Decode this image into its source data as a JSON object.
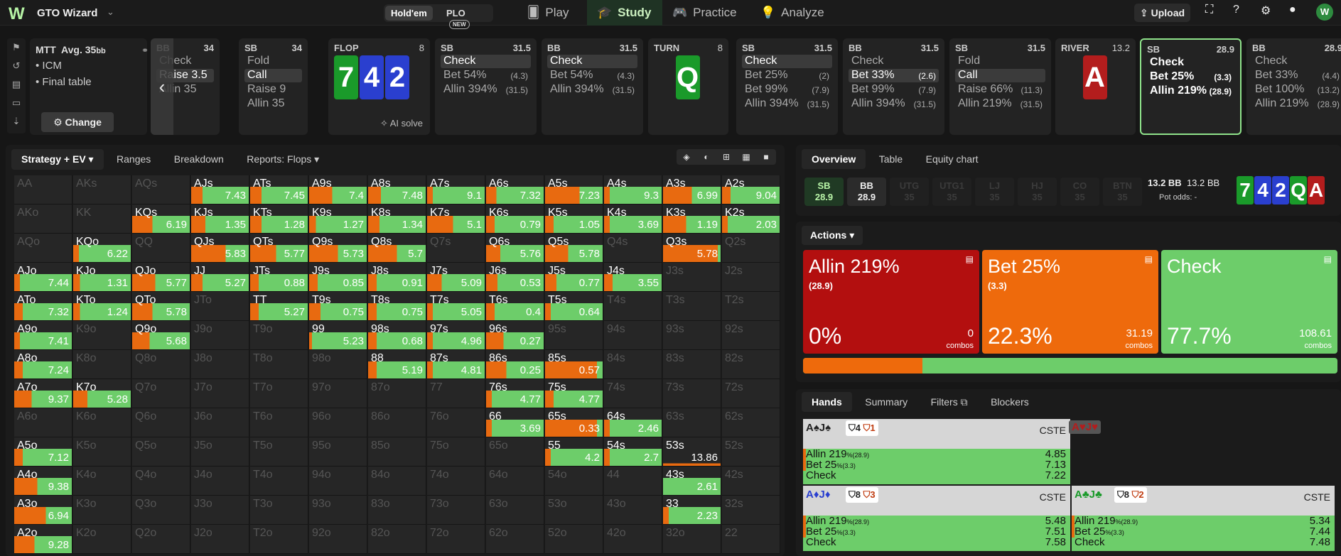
{
  "app": {
    "brand": "GTO Wizard",
    "logo": "W"
  },
  "game_toggle": {
    "holdem": "Hold'em",
    "plo": "PLO",
    "plo_badge": "NEW"
  },
  "nav": {
    "play": "Play",
    "study": "Study",
    "practice": "Practice",
    "analyze": "Analyze"
  },
  "topright": {
    "upload": "Upload",
    "avatar": "W"
  },
  "mtt": {
    "title": "MTT",
    "avg": "Avg. 35",
    "avg_unit": "bb",
    "icm": "• ICM",
    "final_table": "• Final table",
    "change": "Change"
  },
  "path": [
    {
      "pos": "BB",
      "stack": "34",
      "actions": [
        {
          "t": "Check",
          "s": ""
        },
        {
          "t": "Raise 3.5",
          "s": ""
        },
        {
          "t": "Allin 35",
          "s": ""
        }
      ],
      "selected": 1
    },
    {
      "pos": "SB",
      "stack": "34",
      "actions": [
        {
          "t": "Fold",
          "s": ""
        },
        {
          "t": "Call",
          "s": ""
        },
        {
          "t": "Raise 9",
          "s": ""
        },
        {
          "t": "Allin 35",
          "s": ""
        }
      ],
      "selected": 1
    },
    {
      "street": "FLOP",
      "pot": "8",
      "cards": [
        "7",
        "4",
        "2"
      ],
      "ai": "AI solve"
    },
    {
      "pos": "SB",
      "stack": "31.5",
      "actions": [
        {
          "t": "Check",
          "s": ""
        },
        {
          "t": "Bet 54%",
          "s": "(4.3)"
        },
        {
          "t": "Allin 394%",
          "s": "(31.5)"
        }
      ],
      "selected": 0
    },
    {
      "pos": "BB",
      "stack": "31.5",
      "actions": [
        {
          "t": "Check",
          "s": ""
        },
        {
          "t": "Bet 54%",
          "s": "(4.3)"
        },
        {
          "t": "Allin 394%",
          "s": "(31.5)"
        }
      ],
      "selected": 0
    },
    {
      "street": "TURN",
      "pot": "8",
      "cards": [
        "Q"
      ]
    },
    {
      "pos": "SB",
      "stack": "31.5",
      "actions": [
        {
          "t": "Check",
          "s": ""
        },
        {
          "t": "Bet 25%",
          "s": "(2)"
        },
        {
          "t": "Bet 99%",
          "s": "(7.9)"
        },
        {
          "t": "Allin 394%",
          "s": "(31.5)"
        }
      ],
      "selected": 0
    },
    {
      "pos": "BB",
      "stack": "31.5",
      "actions": [
        {
          "t": "Check",
          "s": ""
        },
        {
          "t": "Bet 33%",
          "s": "(2.6)"
        },
        {
          "t": "Bet 99%",
          "s": "(7.9)"
        },
        {
          "t": "Allin 394%",
          "s": "(31.5)"
        }
      ],
      "selected": 1
    },
    {
      "pos": "SB",
      "stack": "31.5",
      "actions": [
        {
          "t": "Fold",
          "s": ""
        },
        {
          "t": "Call",
          "s": ""
        },
        {
          "t": "Raise 66%",
          "s": "(11.3)"
        },
        {
          "t": "Allin 219%",
          "s": "(31.5)"
        }
      ],
      "selected": 1
    },
    {
      "street": "RIVER",
      "pot": "13.2",
      "cards": [
        "A"
      ]
    },
    {
      "pos": "SB",
      "stack": "28.9",
      "actions": [
        {
          "t": "Check",
          "s": ""
        },
        {
          "t": "Bet 25%",
          "s": "(3.3)"
        },
        {
          "t": "Allin 219%",
          "s": "(28.9)"
        }
      ],
      "selected": -1,
      "active": true
    },
    {
      "pos": "BB",
      "stack": "28.9",
      "actions": [
        {
          "t": "Check",
          "s": ""
        },
        {
          "t": "Bet 33%",
          "s": "(4.4)"
        },
        {
          "t": "Bet 100%",
          "s": "(13.2)"
        },
        {
          "t": "Allin 219%",
          "s": "(28.9)"
        }
      ],
      "selected": -1
    }
  ],
  "left_tabs": [
    "Strategy + EV ▾",
    "Ranges",
    "Breakdown",
    "Reports: Flops ▾"
  ],
  "view_tools": [
    "◈",
    "◐",
    "⊞",
    "▦",
    "■"
  ],
  "colors": {
    "green": "#6dcd6a",
    "orange": "#e86a10",
    "red": "#b31d1d",
    "empty": "#262626"
  },
  "matrix": [
    [
      [
        "AA"
      ],
      [
        "AKs"
      ],
      [
        "AQs"
      ],
      [
        "AJs",
        "7.43",
        0.2,
        0
      ],
      [
        "ATs",
        "7.45",
        0.2,
        0
      ],
      [
        "A9s",
        "7.4",
        0.4,
        0
      ],
      [
        "A8s",
        "7.48",
        0.22,
        0
      ],
      [
        "A7s",
        "9.1",
        0.1,
        0
      ],
      [
        "A6s",
        "7.32",
        0.18,
        0
      ],
      [
        "A5s",
        "7.23",
        0.6,
        0
      ],
      [
        "A4s",
        "9.3",
        0.1,
        0
      ],
      [
        "A3s",
        "6.99",
        0.5,
        0
      ],
      [
        "A2s",
        "9.04",
        0.15,
        0
      ]
    ],
    [
      [
        "AKo"
      ],
      [
        "KK"
      ],
      [
        "KQs",
        "6.19",
        0.35,
        0
      ],
      [
        "KJs",
        "1.35",
        0.25,
        0
      ],
      [
        "KTs",
        "1.28",
        0.2,
        0
      ],
      [
        "K9s",
        "1.27",
        0.12,
        0
      ],
      [
        "K8s",
        "1.34",
        0.2,
        0
      ],
      [
        "K7s",
        "5.1",
        0.45,
        0
      ],
      [
        "K6s",
        "0.79",
        0.15,
        0
      ],
      [
        "K5s",
        "1.05",
        0.15,
        0
      ],
      [
        "K4s",
        "3.69",
        0.1,
        0
      ],
      [
        "K3s",
        "1.19",
        0.4,
        0
      ],
      [
        "K2s",
        "2.03",
        0.1,
        0
      ]
    ],
    [
      [
        "AQo"
      ],
      [
        "KQo",
        "6.22",
        0.1,
        0
      ],
      [
        "QQ"
      ],
      [
        "QJs",
        "5.83",
        0.6,
        0
      ],
      [
        "QTs",
        "5.77",
        0.45,
        0
      ],
      [
        "Q9s",
        "5.73",
        0.5,
        0
      ],
      [
        "Q8s",
        "5.7",
        0.5,
        0
      ],
      [
        "Q7s"
      ],
      [
        "Q6s",
        "5.76",
        0.25,
        0
      ],
      [
        "Q5s",
        "5.78",
        0.4,
        0
      ],
      [
        "Q4s"
      ],
      [
        "Q3s",
        "5.78",
        0.95,
        0
      ],
      [
        "Q2s"
      ]
    ],
    [
      [
        "AJo",
        "7.44",
        0.1,
        0
      ],
      [
        "KJo",
        "1.31",
        0.12,
        0
      ],
      [
        "QJo",
        "5.77",
        0.4,
        0
      ],
      [
        "JJ",
        "5.27",
        0.2,
        0
      ],
      [
        "JTs",
        "0.88",
        0.15,
        0
      ],
      [
        "J9s",
        "0.85",
        0.15,
        0
      ],
      [
        "J8s",
        "0.91",
        0.15,
        0
      ],
      [
        "J7s",
        "5.09",
        0.25,
        0
      ],
      [
        "J6s",
        "0.53",
        0.2,
        0
      ],
      [
        "J5s",
        "0.77",
        0.2,
        0
      ],
      [
        "J4s",
        "3.55",
        0.15,
        0
      ],
      [
        "J3s"
      ],
      [
        "J2s"
      ]
    ],
    [
      [
        "ATo",
        "7.32",
        0.15,
        0
      ],
      [
        "KTo",
        "1.24",
        0.12,
        0
      ],
      [
        "QTo",
        "5.78",
        0.35,
        0
      ],
      [
        "JTo"
      ],
      [
        "TT",
        "5.27",
        0.15,
        0
      ],
      [
        "T9s",
        "0.75",
        0.2,
        0
      ],
      [
        "T8s",
        "0.75",
        0.15,
        0
      ],
      [
        "T7s",
        "5.05",
        0.1,
        0
      ],
      [
        "T6s",
        "0.4",
        0.15,
        0
      ],
      [
        "T5s",
        "0.64",
        0.1,
        0
      ],
      [
        "T4s"
      ],
      [
        "T3s"
      ],
      [
        "T2s"
      ]
    ],
    [
      [
        "A9o",
        "7.41",
        0.1,
        0
      ],
      [
        "K9o"
      ],
      [
        "Q9o",
        "5.68",
        0.3,
        0
      ],
      [
        "J9o"
      ],
      [
        "T9o"
      ],
      [
        "99",
        "5.23",
        0.05,
        0
      ],
      [
        "98s",
        "0.68",
        0.15,
        0
      ],
      [
        "97s",
        "4.96",
        0.1,
        0
      ],
      [
        "96s",
        "0.27",
        0.3,
        0
      ],
      [
        "95s"
      ],
      [
        "94s"
      ],
      [
        "93s"
      ],
      [
        "92s"
      ]
    ],
    [
      [
        "A8o",
        "7.24",
        0.15,
        0
      ],
      [
        "K8o"
      ],
      [
        "Q8o"
      ],
      [
        "J8o"
      ],
      [
        "T8o"
      ],
      [
        "98o"
      ],
      [
        "88",
        "5.19",
        0.15,
        0
      ],
      [
        "87s",
        "4.81",
        0.1,
        0
      ],
      [
        "86s",
        "0.25",
        0.35,
        0
      ],
      [
        "85s",
        "0.57",
        0.9,
        0
      ],
      [
        "84s"
      ],
      [
        "83s"
      ],
      [
        "82s"
      ]
    ],
    [
      [
        "A7o",
        "9.37",
        0.3,
        0
      ],
      [
        "K7o",
        "5.28",
        0.25,
        0
      ],
      [
        "Q7o"
      ],
      [
        "J7o"
      ],
      [
        "T7o"
      ],
      [
        "97o"
      ],
      [
        "87o"
      ],
      [
        "77"
      ],
      [
        "76s",
        "4.77",
        0.1,
        0
      ],
      [
        "75s",
        "4.77",
        0.15,
        0
      ],
      [
        "74s"
      ],
      [
        "73s"
      ],
      [
        "72s"
      ]
    ],
    [
      [
        "A6o"
      ],
      [
        "K6o"
      ],
      [
        "Q6o"
      ],
      [
        "J6o"
      ],
      [
        "T6o"
      ],
      [
        "96o"
      ],
      [
        "86o"
      ],
      [
        "76o"
      ],
      [
        "66",
        "3.69",
        0.1,
        0
      ],
      [
        "65s",
        "0.33",
        0.9,
        0
      ],
      [
        "64s",
        "2.46",
        0.1,
        0
      ],
      [
        "63s"
      ],
      [
        "62s"
      ]
    ],
    [
      [
        "A5o",
        "7.12",
        0.15,
        0
      ],
      [
        "K5o"
      ],
      [
        "Q5o"
      ],
      [
        "J5o"
      ],
      [
        "T5o"
      ],
      [
        "95o"
      ],
      [
        "85o"
      ],
      [
        "75o"
      ],
      [
        "65o"
      ],
      [
        "55",
        "4.2",
        0.1,
        0
      ],
      [
        "54s",
        "2.7",
        0.1,
        0
      ],
      [
        "53s",
        "13.86",
        0.1,
        0.85
      ],
      [
        "52s"
      ]
    ],
    [
      [
        "A4o",
        "9.38",
        0.4,
        0
      ],
      [
        "K4o"
      ],
      [
        "Q4o"
      ],
      [
        "J4o"
      ],
      [
        "T4o"
      ],
      [
        "94o"
      ],
      [
        "84o"
      ],
      [
        "74o"
      ],
      [
        "64o"
      ],
      [
        "54o"
      ],
      [
        "44"
      ],
      [
        "43s",
        "2.61",
        0.0,
        0
      ],
      [
        "42s"
      ]
    ],
    [
      [
        "A3o",
        "6.94",
        0.55,
        0
      ],
      [
        "K3o"
      ],
      [
        "Q3o"
      ],
      [
        "J3o"
      ],
      [
        "T3o"
      ],
      [
        "93o"
      ],
      [
        "83o"
      ],
      [
        "73o"
      ],
      [
        "63o"
      ],
      [
        "53o"
      ],
      [
        "43o"
      ],
      [
        "33",
        "2.23",
        0.1,
        0
      ],
      [
        "32s"
      ]
    ],
    [
      [
        "A2o",
        "9.28",
        0.35,
        0
      ],
      [
        "K2o"
      ],
      [
        "Q2o"
      ],
      [
        "J2o"
      ],
      [
        "T2o"
      ],
      [
        "92o"
      ],
      [
        "82o"
      ],
      [
        "72o"
      ],
      [
        "62o"
      ],
      [
        "52o"
      ],
      [
        "42o"
      ],
      [
        "32o"
      ],
      [
        "22"
      ]
    ]
  ],
  "right_tabs": [
    "Overview",
    "Table",
    "Equity chart"
  ],
  "seats": [
    {
      "pos": "SB",
      "stack": "28.9",
      "cls": "sb"
    },
    {
      "pos": "BB",
      "stack": "28.9",
      "cls": "bb"
    },
    {
      "pos": "UTG",
      "stack": "35",
      "cls": ""
    },
    {
      "pos": "UTG1",
      "stack": "35",
      "cls": ""
    },
    {
      "pos": "LJ",
      "stack": "35",
      "cls": ""
    },
    {
      "pos": "HJ",
      "stack": "35",
      "cls": ""
    },
    {
      "pos": "CO",
      "stack": "35",
      "cls": ""
    },
    {
      "pos": "BTN",
      "stack": "35",
      "cls": ""
    }
  ],
  "pot": {
    "a": "13.2 BB",
    "b": "13.2 BB",
    "odds": "Pot odds:  -"
  },
  "board": [
    {
      "r": "7",
      "c": "c-g"
    },
    {
      "r": "4",
      "c": "c-b"
    },
    {
      "r": "2",
      "c": "c-b"
    },
    {
      "r": "Q",
      "c": "c-g"
    },
    {
      "r": "A",
      "c": "c-r"
    }
  ],
  "actions_header": "Actions ▾",
  "action_boxes": [
    {
      "title": "Allin 219%",
      "size": "(28.9)",
      "pct": "0%",
      "combos": "0",
      "combos_label": "combos",
      "color": "#b30f0f"
    },
    {
      "title": "Bet 25%",
      "size": "(3.3)",
      "pct": "22.3%",
      "combos": "31.19",
      "combos_label": "combos",
      "color": "#ee6a0c"
    },
    {
      "title": "Check",
      "size": "",
      "pct": "77.7%",
      "combos": "108.61",
      "combos_label": "combos",
      "color": "#6dcd6a"
    }
  ],
  "freq": {
    "bet": 22.3,
    "check": 77.7
  },
  "hands_tabs": [
    "Hands",
    "Summary",
    "Filters ⧉",
    "Blockers"
  ],
  "hand_cards": [
    {
      "hand": "A♠J♠",
      "suit": "suit-s",
      "b1": "4",
      "b2": "1",
      "cste": "CSTE",
      "rows": [
        [
          "Allin 219",
          "%(28.9)",
          "4.85"
        ],
        [
          "Bet 25",
          "%(3.3)",
          "7.13"
        ],
        [
          "Check",
          "",
          "7.22"
        ]
      ]
    },
    {
      "hand": "A♦J♦",
      "suit": "suit-d",
      "b1": "8",
      "b2": "3",
      "cste": "CSTE",
      "rows": [
        [
          "Allin 219",
          "%(28.9)",
          "5.48"
        ],
        [
          "Bet 25",
          "%(3.3)",
          "7.51"
        ],
        [
          "Check",
          "",
          "7.58"
        ]
      ]
    },
    {
      "hand": "A♣J♣",
      "suit": "suit-c",
      "b1": "8",
      "b2": "2",
      "cste": "CSTE",
      "rows": [
        [
          "Allin 219",
          "%(28.9)",
          "5.34"
        ],
        [
          "Bet 25",
          "%(3.3)",
          "7.44"
        ],
        [
          "Check",
          "",
          "7.48"
        ]
      ]
    }
  ],
  "empty_hand": "A♥J♥"
}
